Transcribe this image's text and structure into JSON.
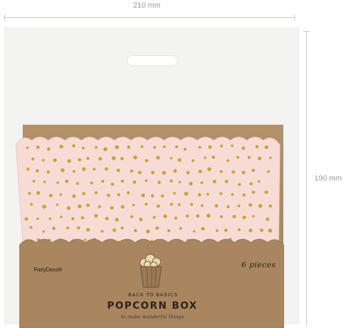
{
  "dimensions": {
    "width_label": "210 mm",
    "height_label": "190 mm"
  },
  "product": {
    "brand": "PartyDeco®",
    "subtitle": "BACK TO BASICS",
    "title": "POPCORN BOX",
    "tagline": "to make wonderful things",
    "count": "6 pieces"
  },
  "colors": {
    "kraft": "#a7845d",
    "box_pink": "#f7dcd6",
    "dots_gold": "#c9a23a",
    "package": "#f3f3f2"
  },
  "icons": {
    "popcorn": "popcorn-box-icon"
  }
}
